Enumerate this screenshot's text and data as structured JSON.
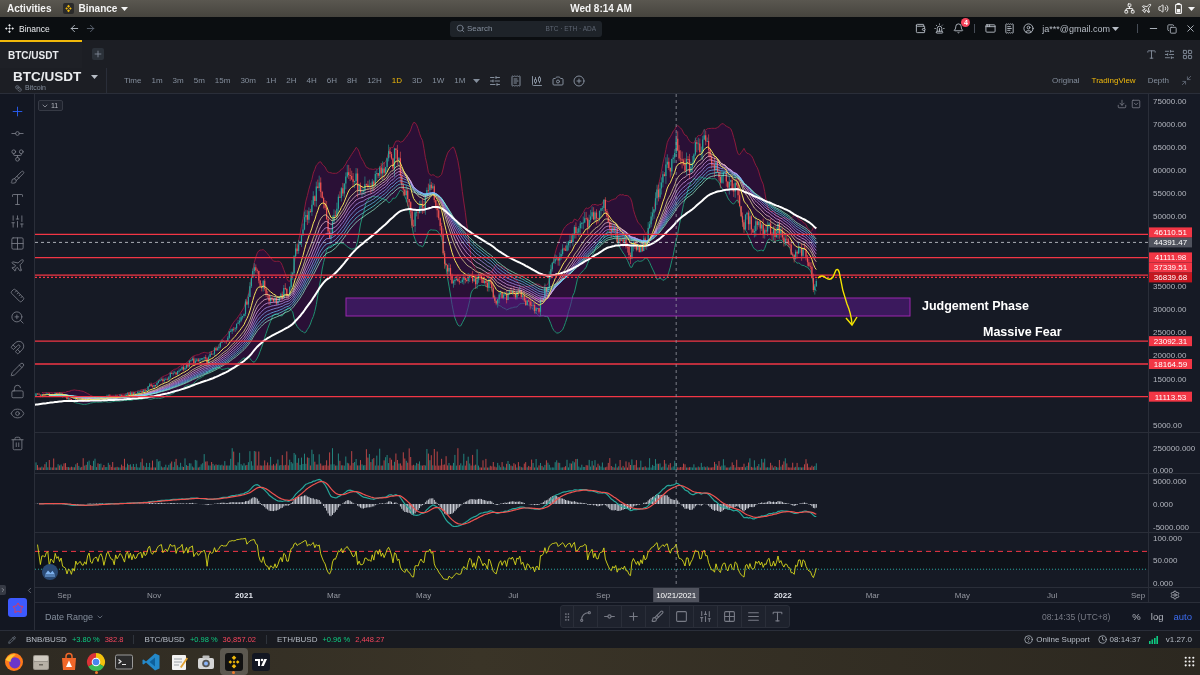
{
  "system_bar": {
    "activities": "Activities",
    "app_menu": "Binance",
    "clock": "Wed 8:14 AM"
  },
  "title_bar": {
    "app_name": "Binance",
    "search": {
      "placeholder": "Search",
      "suggestions": "BTC · ETH · ADA"
    },
    "notification_badge": "4",
    "account": "ja***@gmail.com"
  },
  "tabs": [
    {
      "label": "BTC/USDT",
      "selected": true
    }
  ],
  "symbol": {
    "pair": "BTC/USDT",
    "name": "Bitcoin"
  },
  "intervals": [
    {
      "label": "Time",
      "selected": false
    },
    {
      "label": "1m",
      "selected": false
    },
    {
      "label": "3m",
      "selected": false
    },
    {
      "label": "5m",
      "selected": false
    },
    {
      "label": "15m",
      "selected": false
    },
    {
      "label": "30m",
      "selected": false
    },
    {
      "label": "1H",
      "selected": false
    },
    {
      "label": "2H",
      "selected": false
    },
    {
      "label": "4H",
      "selected": false
    },
    {
      "label": "6H",
      "selected": false
    },
    {
      "label": "8H",
      "selected": false
    },
    {
      "label": "12H",
      "selected": false
    },
    {
      "label": "1D",
      "selected": true
    },
    {
      "label": "3D",
      "selected": false
    },
    {
      "label": "1W",
      "selected": false
    },
    {
      "label": "1M",
      "selected": false
    }
  ],
  "chart_views": [
    {
      "label": "Original",
      "selected": false
    },
    {
      "label": "TradingView",
      "selected": true
    },
    {
      "label": "Depth",
      "selected": false
    }
  ],
  "drawing_tools": [
    {
      "kind": "crosshair",
      "selected": true
    },
    {
      "kind": "horizontal_line",
      "selected": false
    },
    {
      "kind": "pitchfork",
      "selected": false
    },
    {
      "kind": "brush",
      "selected": false
    },
    {
      "kind": "text",
      "selected": false
    },
    {
      "kind": "pattern",
      "selected": false
    },
    {
      "kind": "measure_grid",
      "selected": false
    },
    {
      "kind": "airplane",
      "selected": false
    },
    {
      "kind": "ruler",
      "selected": false
    },
    {
      "kind": "zoom",
      "selected": false
    },
    {
      "kind": "magnet",
      "selected": false
    },
    {
      "kind": "lock_drawings",
      "selected": false
    },
    {
      "kind": "unlock",
      "selected": false
    },
    {
      "kind": "visibility",
      "selected": false
    },
    {
      "kind": "remove",
      "selected": false
    }
  ],
  "chart": {
    "indicator_count": "11",
    "price_axis": [
      "75000.00",
      "70000.00",
      "65000.00",
      "60000.00",
      "55000.00",
      "50000.00",
      "35000.00",
      "30000.00",
      "25000.00",
      "20000.00",
      "15000.00",
      "5000.00"
    ],
    "levels": [
      {
        "price": "46110.51",
        "kind": "line"
      },
      {
        "price": "41111.98",
        "kind": "line"
      },
      {
        "price": "37339.51",
        "kind": "line"
      },
      {
        "price": "36839.68",
        "kind": "last_price"
      },
      {
        "price": "23092.31",
        "kind": "line"
      },
      {
        "price": "18164.59",
        "kind": "line"
      },
      {
        "price": "11113.53",
        "kind": "line"
      }
    ],
    "crosshair": {
      "price": "44391.47",
      "date": "10/21/2021"
    },
    "annotations": [
      "Judgement Phase",
      "Massive Fear"
    ],
    "volume_axis": [
      "250000.000",
      "0.000"
    ],
    "macd_axis": [
      "5000.000",
      "0.000",
      "-5000.000"
    ],
    "rsi_axis": [
      "100.000",
      "50.000",
      "0.000"
    ],
    "time_axis": [
      {
        "label": "Sep",
        "kind": "month"
      },
      {
        "label": "Nov",
        "kind": "month"
      },
      {
        "label": "2021",
        "kind": "year"
      },
      {
        "label": "Mar",
        "kind": "month"
      },
      {
        "label": "May",
        "kind": "month"
      },
      {
        "label": "Jul",
        "kind": "month"
      },
      {
        "label": "Sep",
        "kind": "month"
      },
      {
        "label": "2022",
        "kind": "year"
      },
      {
        "label": "Mar",
        "kind": "month"
      },
      {
        "label": "May",
        "kind": "month"
      },
      {
        "label": "Jul",
        "kind": "month"
      },
      {
        "label": "Sep",
        "kind": "month"
      }
    ]
  },
  "bottom_bar": {
    "date_range": "Date Range",
    "time": "08:14:35 (UTC+8)",
    "scales": [
      {
        "label": "%",
        "selected": false
      },
      {
        "label": "log",
        "selected": false
      },
      {
        "label": "auto",
        "selected": true
      }
    ]
  },
  "tickers": [
    {
      "pair": "BNB/BUSD",
      "change": "+3.80 %",
      "price": "382.8"
    },
    {
      "pair": "BTC/BUSD",
      "change": "+0.98 %",
      "price": "36,857.02"
    },
    {
      "pair": "ETH/BUSD",
      "change": "+0.96 %",
      "price": "2,448.27"
    }
  ],
  "status": {
    "support": "Online Support",
    "clock": "08:14:37",
    "version": "v1.27.0"
  },
  "dock": [
    {
      "kind": "fox_browser",
      "selected": false,
      "running": false
    },
    {
      "kind": "file_manager",
      "selected": false,
      "running": false
    },
    {
      "kind": "app_store",
      "selected": false,
      "running": false
    },
    {
      "kind": "web_browser",
      "selected": false,
      "running": true
    },
    {
      "kind": "terminal",
      "selected": false,
      "running": false
    },
    {
      "kind": "code_editor",
      "selected": false,
      "running": false
    },
    {
      "kind": "text_editor",
      "selected": false,
      "running": false
    },
    {
      "kind": "camera",
      "selected": false,
      "running": false
    },
    {
      "kind": "exchange",
      "selected": true,
      "running": true
    },
    {
      "kind": "charting",
      "selected": false,
      "running": false
    }
  ]
}
